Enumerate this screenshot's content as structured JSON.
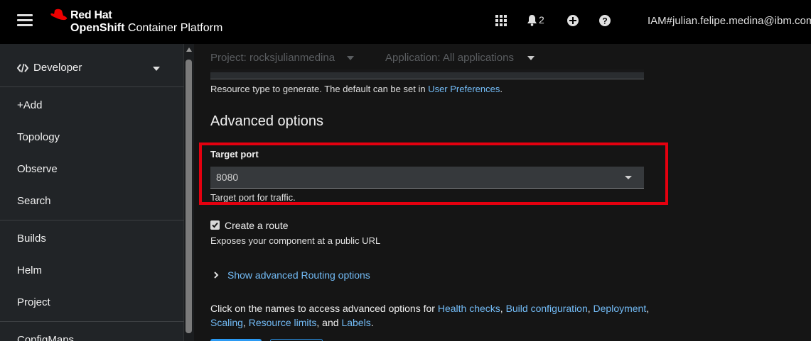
{
  "masthead": {
    "brand_line1": "Red Hat",
    "brand_line2_bold": "OpenShift",
    "brand_line2_rest": " Container Platform",
    "notification_count": "2",
    "user": "IAM#julian.felipe.medina@ibm.com",
    "icons": [
      "menu-icon",
      "app-launcher-icon",
      "bell-icon",
      "plus-circle-icon",
      "question-circle-icon"
    ]
  },
  "sidebar": {
    "perspective": "Developer",
    "items": [
      {
        "label": "+Add"
      },
      {
        "label": "Topology"
      },
      {
        "label": "Observe"
      },
      {
        "label": "Search"
      },
      {
        "label": "Builds"
      },
      {
        "label": "Helm"
      },
      {
        "label": "Project"
      },
      {
        "label": "ConfigMaps"
      }
    ]
  },
  "context": {
    "project": "Project: rocksjulianmedina",
    "application": "Application: All applications"
  },
  "form": {
    "resource_type_helper_prefix": "Resource type to generate. The default can be set in ",
    "resource_type_helper_link": "User Preferences",
    "resource_type_helper_suffix": ".",
    "section_title": "Advanced options",
    "target_port_label": "Target port",
    "target_port_value": "8080",
    "target_port_helper": "Target port for traffic.",
    "create_route_label": "Create a route",
    "create_route_checked": true,
    "create_route_helper": "Exposes your component at a public URL",
    "routing_toggle": "Show advanced Routing options",
    "advanced_text_prefix": "Click on the names to access advanced options for ",
    "links": {
      "health": "Health checks",
      "build": "Build configuration",
      "deployment": "Deployment",
      "scaling": "Scaling",
      "limits": "Resource limits",
      "labels": "Labels"
    },
    "sep_comma": ", ",
    "sep_and": ", and ",
    "end": "."
  },
  "colors": {
    "link": "#73bcf7",
    "highlight": "#e4000f",
    "brand_red": "#ee0000"
  }
}
